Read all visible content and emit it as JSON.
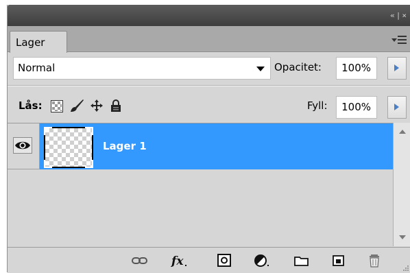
{
  "titlebar": {
    "controls": "«|×"
  },
  "tab": {
    "label": "Lager"
  },
  "blend": {
    "mode": "Normal",
    "opacity_label": "Opacitet:",
    "opacity_value": "100%"
  },
  "lock": {
    "label": "Lås:",
    "fill_label": "Fyll:",
    "fill_value": "100%"
  },
  "layers": [
    {
      "name": "Lager 1",
      "visible": true,
      "selected": true
    }
  ],
  "bottom_icons": [
    "link-layers-icon",
    "fx-icon",
    "layer-mask-icon",
    "adjustment-layer-icon",
    "group-folder-icon",
    "new-layer-icon",
    "trash-icon"
  ],
  "colors": {
    "selection": "#3399ff",
    "panel_bg": "#d6d6d6",
    "titlebar": "#4a4a4a",
    "tab_strip": "#a9a9a9"
  }
}
